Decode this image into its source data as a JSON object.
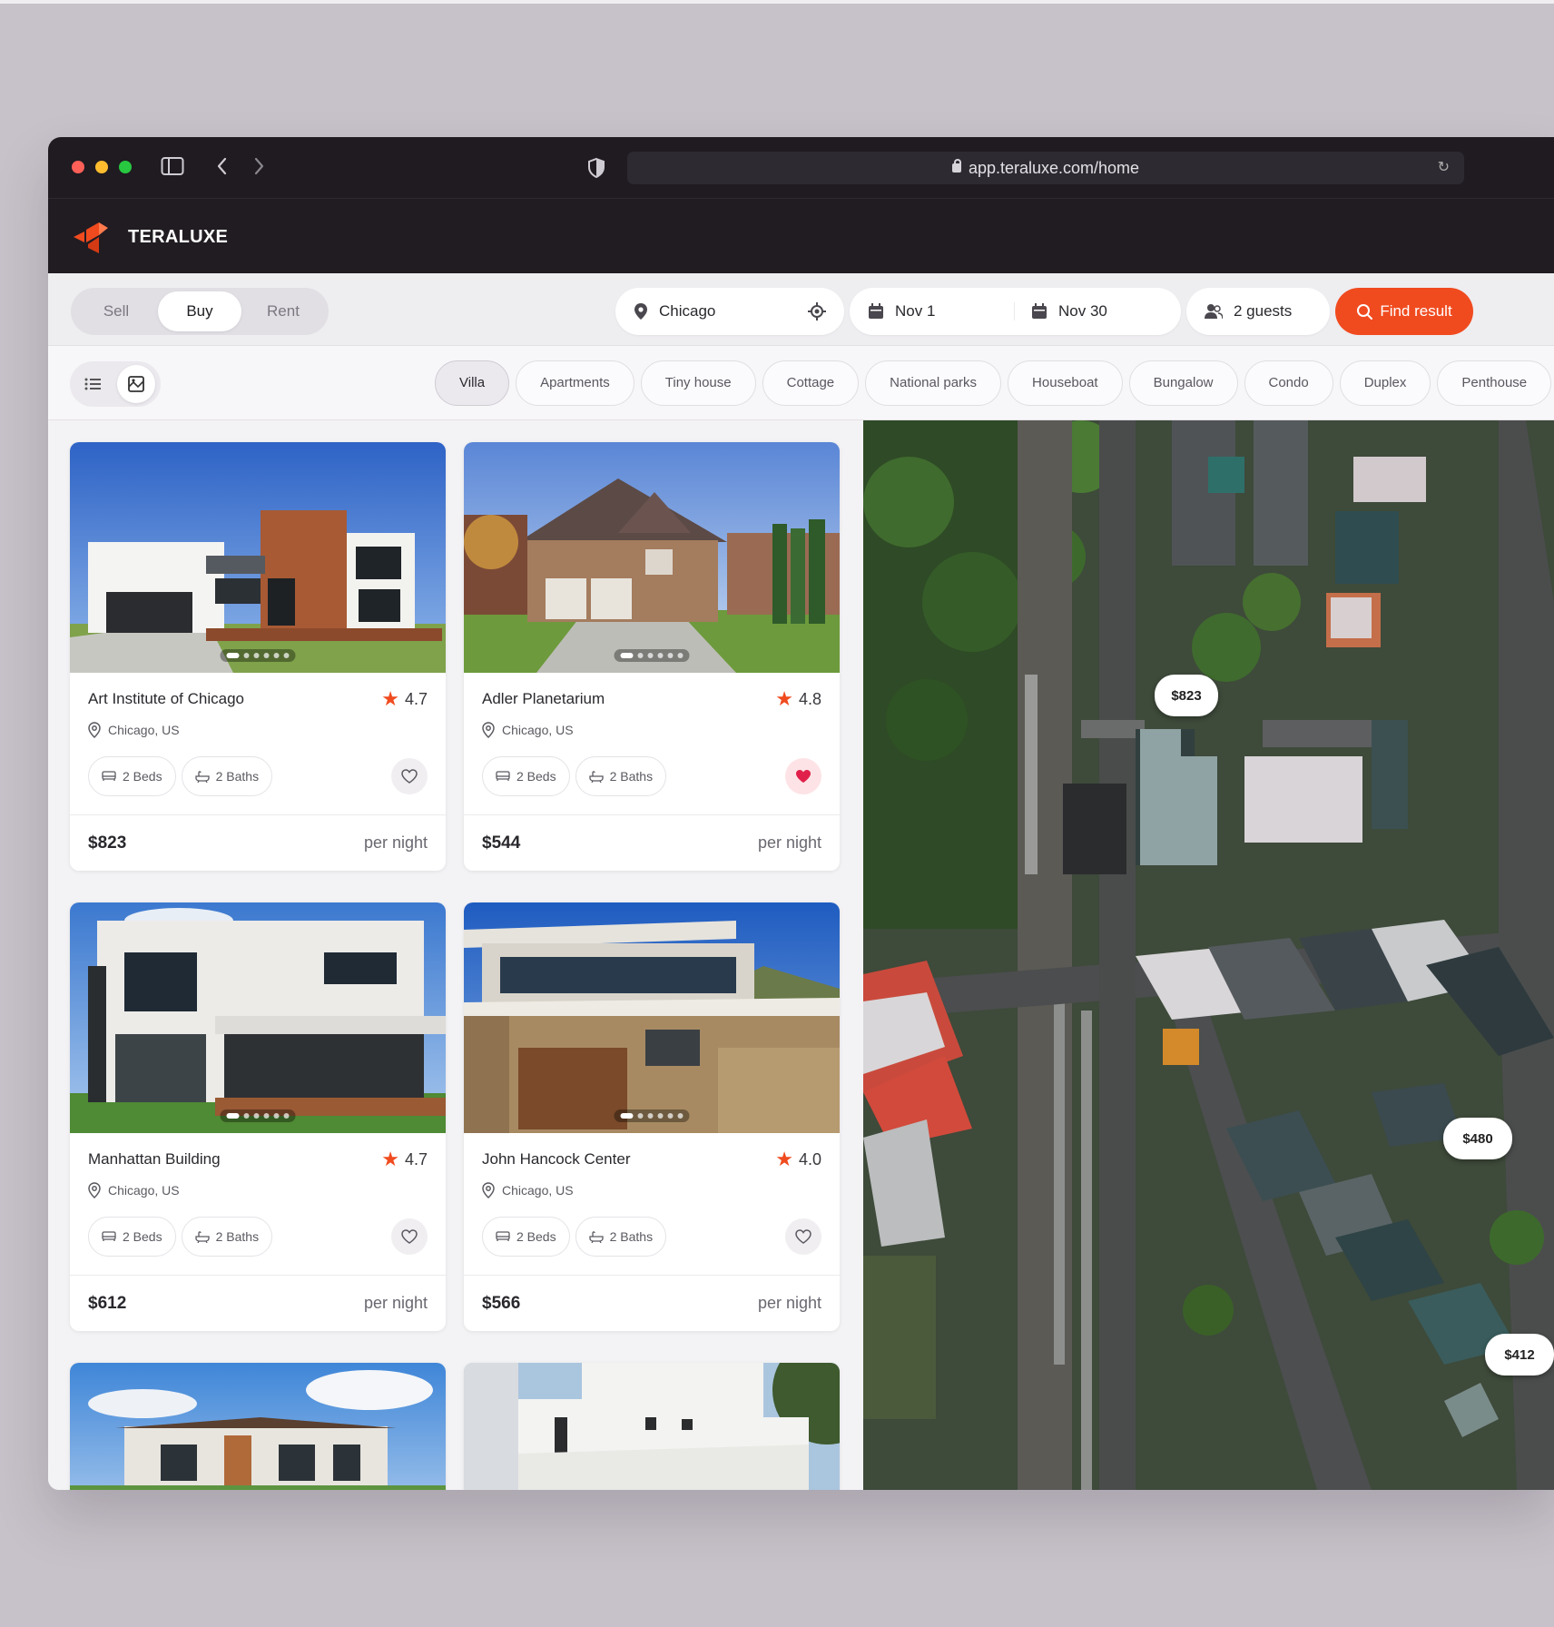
{
  "browser": {
    "url": "app.teraluxe.com/home"
  },
  "brand": {
    "name": "TERALUXE"
  },
  "search": {
    "modes": [
      "Sell",
      "Buy",
      "Rent"
    ],
    "active_mode": "Buy",
    "location": "Chicago",
    "check_in": "Nov 1",
    "check_out": "Nov 30",
    "guests": "2 guests",
    "find_label": "Find result",
    "accent_color": "#f04b1f"
  },
  "filters": {
    "view_modes": [
      "list-icon",
      "map-icon"
    ],
    "active_view": "map-icon",
    "categories": [
      "Villa",
      "Apartments",
      "Tiny house",
      "Cottage",
      "National parks",
      "Houseboat",
      "Bungalow",
      "Condo",
      "Duplex",
      "Penthouse"
    ],
    "active_category": "Villa"
  },
  "listings": [
    {
      "title": "Art Institute of Chicago",
      "rating": "4.7",
      "location": "Chicago, US",
      "beds": "2 Beds",
      "baths": "2 Baths",
      "price": "$823",
      "per": "per night",
      "favorite": false
    },
    {
      "title": "Adler Planetarium",
      "rating": "4.8",
      "location": "Chicago, US",
      "beds": "2 Beds",
      "baths": "2 Baths",
      "price": "$544",
      "per": "per night",
      "favorite": true
    },
    {
      "title": "Manhattan Building",
      "rating": "4.7",
      "location": "Chicago, US",
      "beds": "2 Beds",
      "baths": "2 Baths",
      "price": "$612",
      "per": "per night",
      "favorite": false
    },
    {
      "title": "John Hancock Center",
      "rating": "4.0",
      "location": "Chicago, US",
      "beds": "2 Beds",
      "baths": "2 Baths",
      "price": "$566",
      "per": "per night",
      "favorite": false
    }
  ],
  "map": {
    "pins": [
      "$823",
      "$480",
      "$412"
    ]
  }
}
